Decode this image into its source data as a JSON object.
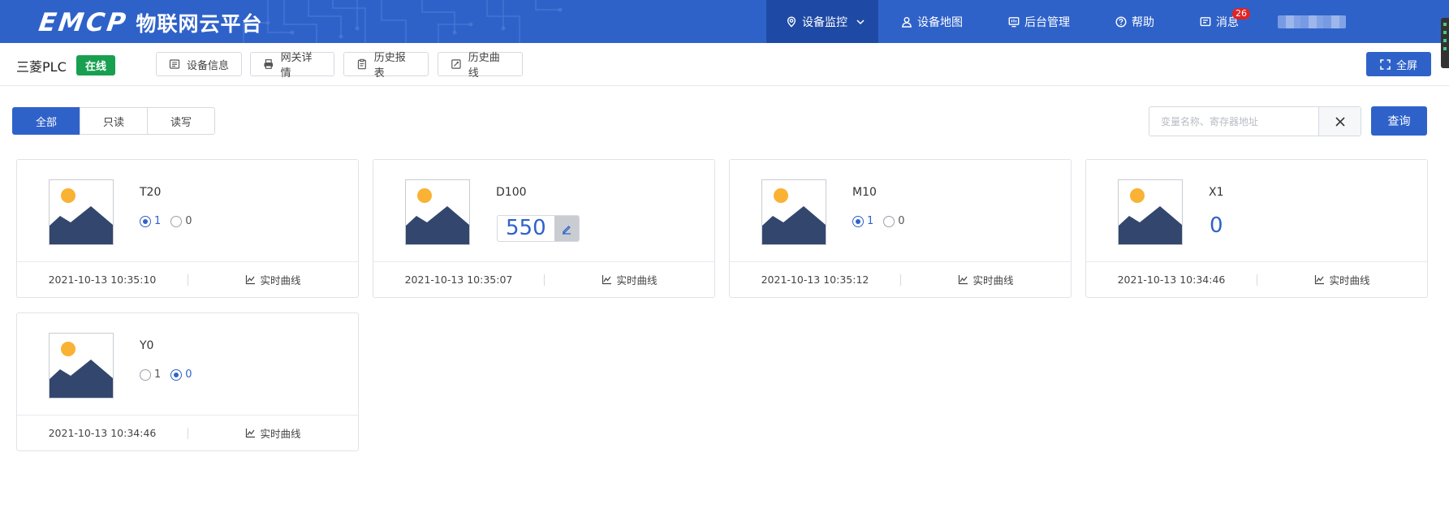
{
  "brand": {
    "logo": "EMCP",
    "name": "物联网云平台"
  },
  "nav": {
    "items": [
      {
        "label": "设备监控",
        "icon": "location-pin-icon",
        "active": true
      },
      {
        "label": "设备地图",
        "icon": "user-icon"
      },
      {
        "label": "后台管理",
        "icon": "monitor-icon"
      },
      {
        "label": "帮助",
        "icon": "question-icon"
      },
      {
        "label": "消息",
        "icon": "message-icon",
        "badge": "26"
      }
    ]
  },
  "device": {
    "name": "三菱PLC",
    "status": "在线",
    "buttons": [
      "设备信息",
      "网关详情",
      "历史报表",
      "历史曲线"
    ],
    "fullscreen": "全屏"
  },
  "filter": {
    "tabs": [
      "全部",
      "只读",
      "读写"
    ],
    "active_tab": 0,
    "search_placeholder": "变量名称、寄存器地址",
    "query_label": "查询"
  },
  "variables": [
    {
      "name": "T20",
      "type": "switch",
      "value": "1",
      "options": [
        "1",
        "0"
      ],
      "time": "2021-10-13 10:35:10",
      "curve_label": "实时曲线"
    },
    {
      "name": "D100",
      "type": "editable",
      "value": "550",
      "time": "2021-10-13 10:35:07",
      "curve_label": "实时曲线"
    },
    {
      "name": "M10",
      "type": "switch",
      "value": "1",
      "options": [
        "1",
        "0"
      ],
      "time": "2021-10-13 10:35:12",
      "curve_label": "实时曲线"
    },
    {
      "name": "X1",
      "type": "readonly",
      "value": "0",
      "time": "2021-10-13 10:34:46",
      "curve_label": "实时曲线"
    },
    {
      "name": "Y0",
      "type": "switch",
      "value": "0",
      "options": [
        "1",
        "0"
      ],
      "time": "2021-10-13 10:34:46",
      "curve_label": "实时曲线"
    }
  ],
  "colors": {
    "primary": "#2f62c9",
    "nav_active": "#1e4aa6",
    "online": "#18a050",
    "badge": "#e02424"
  }
}
